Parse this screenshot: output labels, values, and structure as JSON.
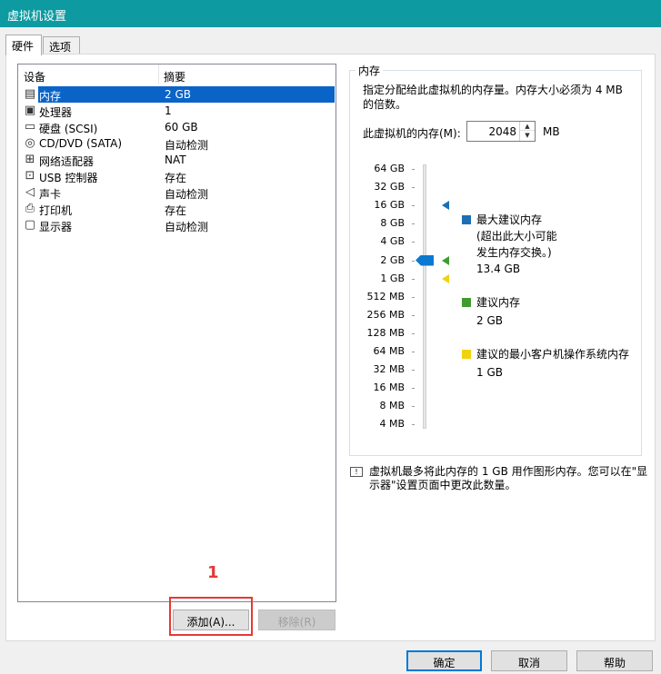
{
  "window": {
    "title": "虚拟机设置"
  },
  "tabs": [
    {
      "label": "硬件"
    },
    {
      "label": "选项"
    }
  ],
  "device_table": {
    "headers": [
      "设备",
      "摘要"
    ],
    "rows": [
      {
        "name": "内存",
        "summary": "2 GB",
        "icon": "memory-icon"
      },
      {
        "name": "处理器",
        "summary": "1",
        "icon": "processor-icon"
      },
      {
        "name": "硬盘 (SCSI)",
        "summary": "60 GB",
        "icon": "harddisk-icon"
      },
      {
        "name": "CD/DVD (SATA)",
        "summary": "自动检测",
        "icon": "cd-dvd-icon"
      },
      {
        "name": "网络适配器",
        "summary": "NAT",
        "icon": "network-adapter-icon"
      },
      {
        "name": "USB 控制器",
        "summary": "存在",
        "icon": "usb-icon"
      },
      {
        "name": "声卡",
        "summary": "自动检测",
        "icon": "sound-icon"
      },
      {
        "name": "打印机",
        "summary": "存在",
        "icon": "printer-icon"
      },
      {
        "name": "显示器",
        "summary": "自动检测",
        "icon": "display-icon"
      }
    ],
    "selected_row": 0
  },
  "list_buttons": {
    "add": "添加(A)...",
    "remove": "移除(R)"
  },
  "annotation_marker": "1",
  "memory": {
    "group_title": "内存",
    "description": "指定分配给此虚拟机的内存量。内存大小必须为 4 MB 的倍数。",
    "field_label": "此虚拟机的内存(M):",
    "value": "2048",
    "unit": "MB",
    "scale": [
      "64 GB",
      "32 GB",
      "16 GB",
      "8 GB",
      "4 GB",
      "2 GB",
      "1 GB",
      "512 MB",
      "256 MB",
      "128 MB",
      "64 MB",
      "32 MB",
      "16 MB",
      "8 MB",
      "4 MB"
    ],
    "current_scale_index": 5,
    "legend": [
      {
        "title": "最大建议内存",
        "note": "(超出此大小可能发生内存交换。)",
        "value": "13.4 GB",
        "color": "#1a6fb5",
        "scale_index": 2
      },
      {
        "title": "建议内存",
        "value": "2 GB",
        "color": "#3f9b2f",
        "scale_index": 5
      },
      {
        "title": "建议的最小客户机操作系统内存",
        "value": "1 GB",
        "color": "#f2d20e",
        "scale_index": 6
      }
    ]
  },
  "info_text": "虚拟机最多将此内存的 1 GB 用作图形内存。您可以在\"显示器\"设置页面中更改此数量。",
  "dialog_buttons": {
    "ok": "确定",
    "cancel": "取消",
    "help": "帮助"
  },
  "colors": {
    "titlebar": "#0d9aa1",
    "selection": "#0a64c8",
    "slider_thumb": "#0a7ad1",
    "annotation": "#e53935"
  }
}
